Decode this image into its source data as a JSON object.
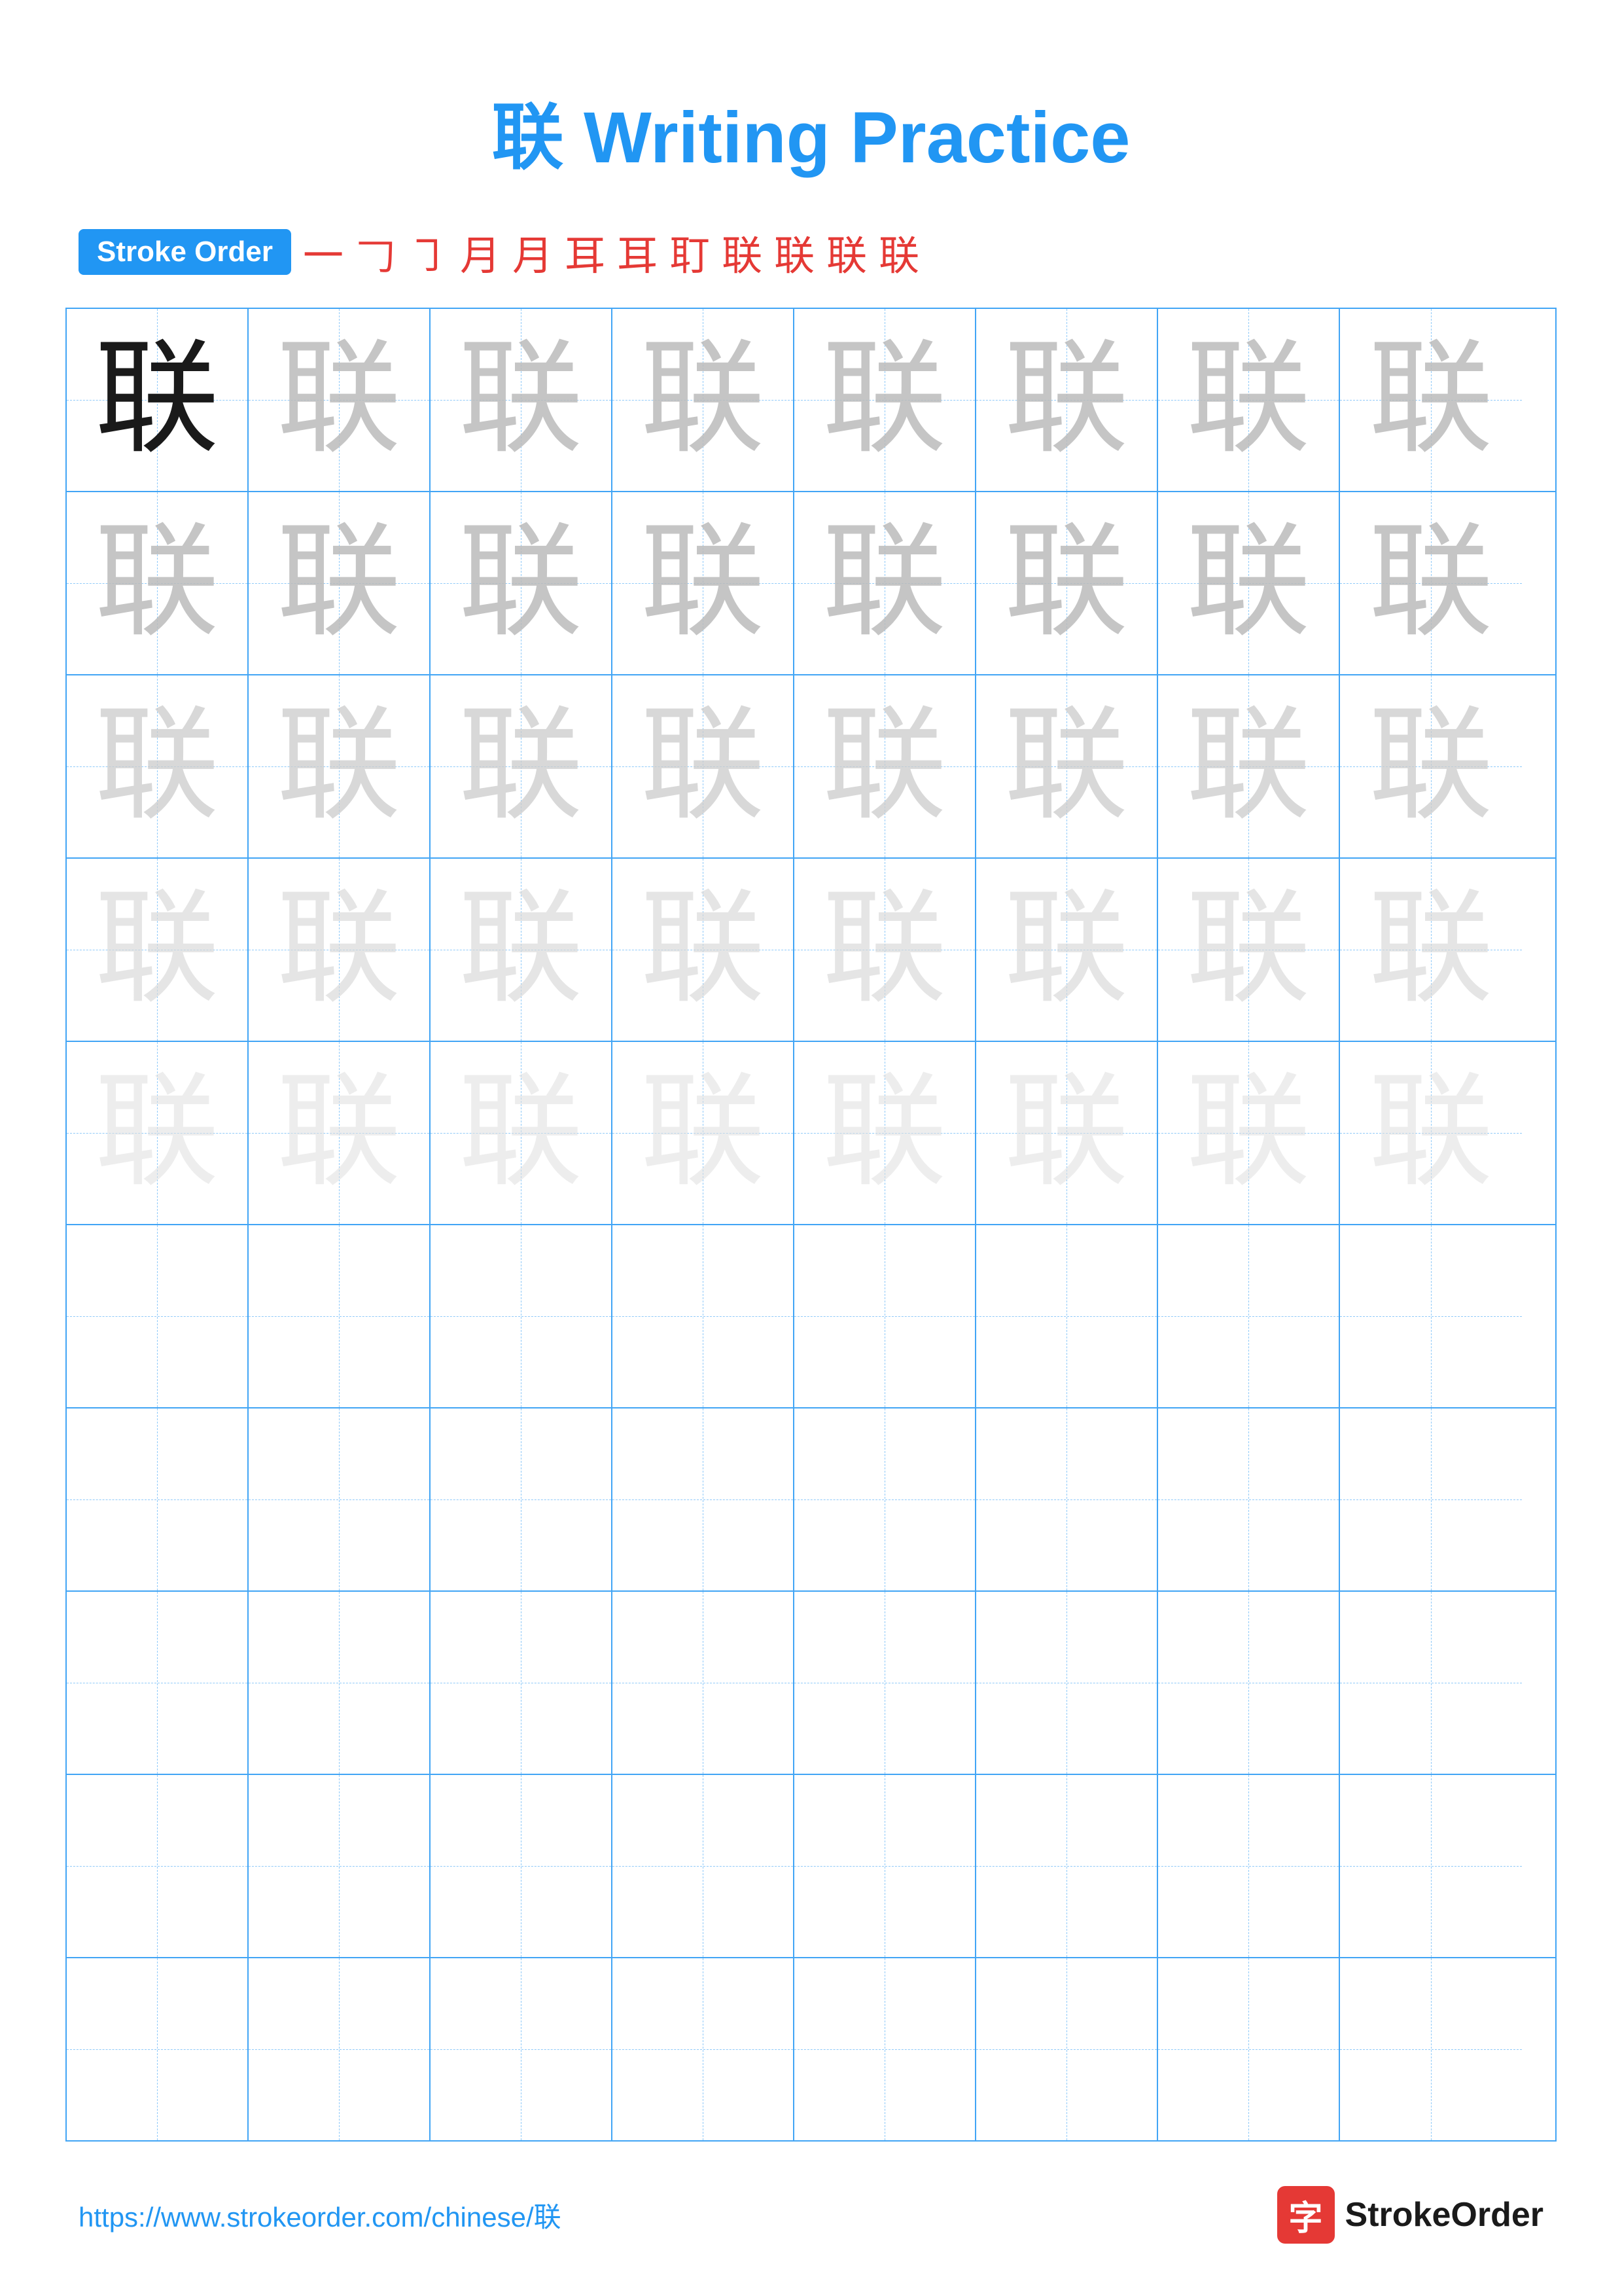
{
  "title": "联 Writing Practice",
  "stroke_order": {
    "label": "Stroke Order",
    "steps": [
      "一",
      "𠃌",
      "㇆",
      "月",
      "月",
      "耳",
      "耳",
      "耳'",
      "联",
      "联",
      "联",
      "联"
    ]
  },
  "character": "联",
  "rows": [
    {
      "type": "practice",
      "cells": [
        "solid",
        "light1",
        "light1",
        "light1",
        "light1",
        "light1",
        "light1",
        "light1"
      ]
    },
    {
      "type": "practice",
      "cells": [
        "light1",
        "light1",
        "light1",
        "light1",
        "light1",
        "light1",
        "light1",
        "light1"
      ]
    },
    {
      "type": "practice",
      "cells": [
        "light2",
        "light2",
        "light2",
        "light2",
        "light2",
        "light2",
        "light2",
        "light2"
      ]
    },
    {
      "type": "practice",
      "cells": [
        "light3",
        "light3",
        "light3",
        "light3",
        "light3",
        "light3",
        "light3",
        "light3"
      ]
    },
    {
      "type": "practice",
      "cells": [
        "light4",
        "light4",
        "light4",
        "light4",
        "light4",
        "light4",
        "light4",
        "light4"
      ]
    },
    {
      "type": "empty",
      "cells": [
        "empty",
        "empty",
        "empty",
        "empty",
        "empty",
        "empty",
        "empty",
        "empty"
      ]
    },
    {
      "type": "empty",
      "cells": [
        "empty",
        "empty",
        "empty",
        "empty",
        "empty",
        "empty",
        "empty",
        "empty"
      ]
    },
    {
      "type": "empty",
      "cells": [
        "empty",
        "empty",
        "empty",
        "empty",
        "empty",
        "empty",
        "empty",
        "empty"
      ]
    },
    {
      "type": "empty",
      "cells": [
        "empty",
        "empty",
        "empty",
        "empty",
        "empty",
        "empty",
        "empty",
        "empty"
      ]
    },
    {
      "type": "empty",
      "cells": [
        "empty",
        "empty",
        "empty",
        "empty",
        "empty",
        "empty",
        "empty",
        "empty"
      ]
    }
  ],
  "footer": {
    "url": "https://www.strokeorder.com/chinese/联",
    "logo_char": "字",
    "logo_name": "StrokeOrder"
  }
}
